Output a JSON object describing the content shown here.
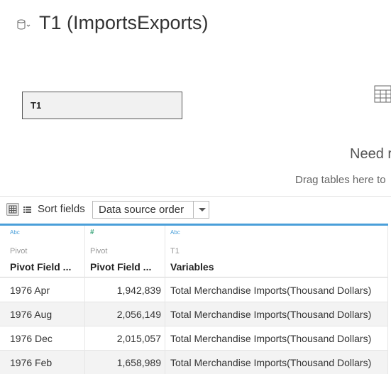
{
  "header": {
    "title": "T1 (ImportsExports)",
    "datasource_icon": "database-icon"
  },
  "canvas": {
    "table_pill_label": "T1",
    "need_more_text": "Need r",
    "drag_hint_text": "Drag tables here to",
    "grid_icon": "table-grid-icon"
  },
  "toolbar": {
    "grid_view_icon": "grid-view-icon",
    "list_view_icon": "list-view-icon",
    "sort_label": "Sort fields",
    "sort_value": "Data source order"
  },
  "table": {
    "columns": [
      {
        "type_glyph": "Abc",
        "source": "Pivot",
        "name": "Pivot Field ..."
      },
      {
        "type_glyph": "#",
        "source": "Pivot",
        "name": "Pivot Field ..."
      },
      {
        "type_glyph": "Abc",
        "source": "T1",
        "name": "Variables"
      }
    ],
    "rows": [
      [
        "1976 Apr",
        "1,942,839",
        "Total Merchandise Imports(Thousand Dollars)"
      ],
      [
        "1976 Aug",
        "2,056,149",
        "Total Merchandise Imports(Thousand Dollars)"
      ],
      [
        "1976 Dec",
        "2,015,057",
        "Total Merchandise Imports(Thousand Dollars)"
      ],
      [
        "1976 Feb",
        "1,658,989",
        "Total Merchandise Imports(Thousand Dollars)"
      ]
    ]
  },
  "colors": {
    "accent": "#4a9fd9",
    "numeric_type": "#3aa57a"
  }
}
